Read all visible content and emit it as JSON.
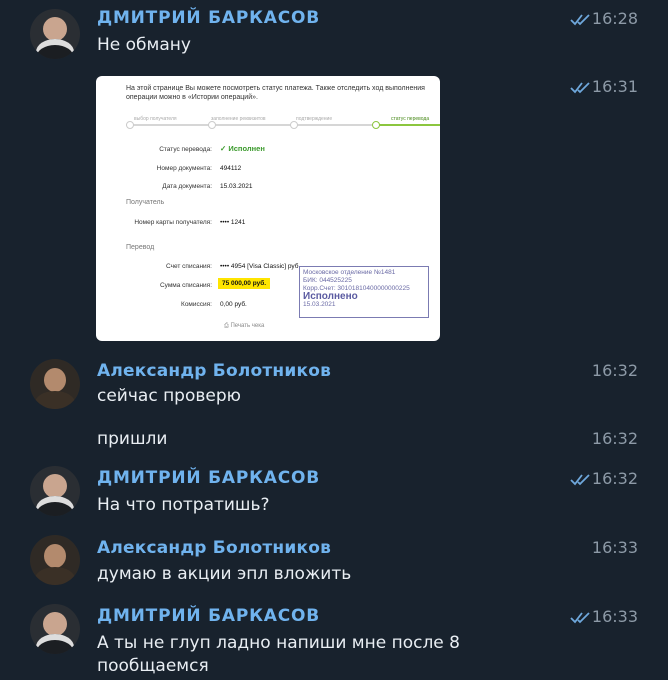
{
  "senders": {
    "dmitry": "ДМИТРИЙ БАРКАСОВ",
    "alexander": "Александр Болотников"
  },
  "messages": [
    {
      "sender": "ДМИТРИЙ БАРКАСОВ",
      "text": "Не обману",
      "time": "16:28",
      "read": true
    },
    {
      "sender": "ДМИТРИЙ БАРКАСОВ",
      "text": "",
      "time": "16:31",
      "read": true,
      "attachment": "payment-screenshot"
    },
    {
      "sender": "Александр Болотников",
      "text": "сейчас проверю",
      "time": "16:32"
    },
    {
      "sender": "Александр Болотников",
      "text": "пришли",
      "time": "16:32"
    },
    {
      "sender": "ДМИТРИЙ БАРКАСОВ",
      "text": "На что потратишь?",
      "time": "16:32",
      "read": true
    },
    {
      "sender": "Александр Болотников",
      "text": "думаю в акции эпл вложить",
      "time": "16:33"
    },
    {
      "sender": "ДМИТРИЙ БАРКАСОВ",
      "text": "А ты не глуп ладно напиши мне после 8 пообщаемся",
      "time": "16:33",
      "read": true
    }
  ],
  "shot": {
    "intro": "На этой странице Вы можете посмотреть статус платежа. Также отследить ход выполнения операции можно в «Истории операций».",
    "steps": [
      "выбор получателя",
      "заполнение реквизитов",
      "подтверждение",
      "статус перевода"
    ],
    "status_label": "Статус перевода:",
    "status_value": "✓ Исполнен",
    "doc_num_label": "Номер документа:",
    "doc_num_value": "494112",
    "doc_date_label": "Дата документа:",
    "doc_date_value": "15.03.2021",
    "recipient_section": "Получатель",
    "card_label": "Номер карты получателя:",
    "card_value": "•••• 1241",
    "transfer_section": "Перевод",
    "account_label": "Счет списания:",
    "account_value": "•••• 4954 [Visa Classic] руб.",
    "amount_label": "Сумма списания:",
    "amount_value": "75 000,00 руб.",
    "fee_label": "Комиссия:",
    "fee_value": "0,00 руб.",
    "print_label": "Печать чека",
    "stamp": {
      "line1": "Московское отделение №1481",
      "line2": "БИК: 044525225",
      "line3": "Корр.Счет: 30101810400000000225",
      "big": "Исполнено",
      "date": "15.03.2021"
    }
  }
}
